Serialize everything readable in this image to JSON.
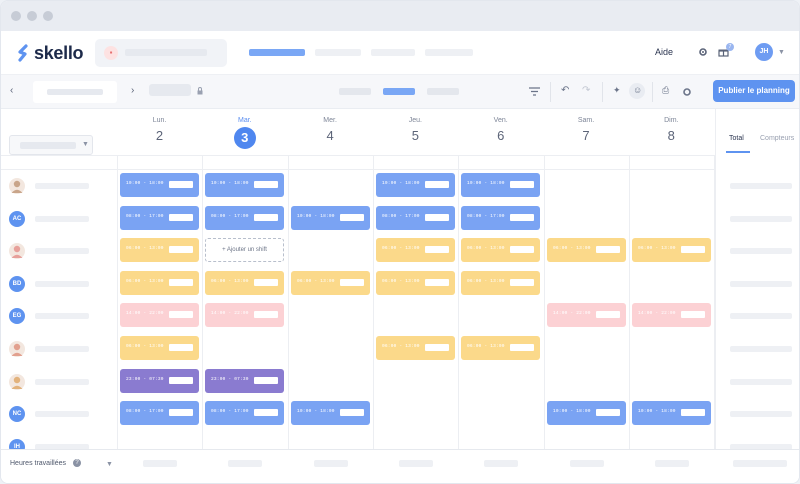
{
  "brand": {
    "name": "skello",
    "accent": "#5e93f0"
  },
  "topbar": {
    "help_label": "Aide",
    "user_initials": "JH",
    "notif_count": "7"
  },
  "toolbar": {
    "publish_label": "Publier le planning"
  },
  "days": [
    {
      "name": "Lun.",
      "num": "2",
      "today": false
    },
    {
      "name": "Mar.",
      "num": "3",
      "today": true
    },
    {
      "name": "Mer.",
      "num": "4",
      "today": false
    },
    {
      "name": "Jeu.",
      "num": "5",
      "today": false
    },
    {
      "name": "Ven.",
      "num": "6",
      "today": false
    },
    {
      "name": "Sam.",
      "num": "7",
      "today": false
    },
    {
      "name": "Dim.",
      "num": "8",
      "today": false
    }
  ],
  "right_panel": {
    "tab_total": "Total",
    "tab_counters": "Compteurs"
  },
  "employees": [
    {
      "initials": "",
      "photo": true,
      "color": "#c9a58a"
    },
    {
      "initials": "AC",
      "photo": false,
      "color": "#5e93f0"
    },
    {
      "initials": "",
      "photo": true,
      "color": "#e7a09a"
    },
    {
      "initials": "BD",
      "photo": false,
      "color": "#5e93f0"
    },
    {
      "initials": "EG",
      "photo": false,
      "color": "#5e93f0"
    },
    {
      "initials": "",
      "photo": true,
      "color": "#e2a08e"
    },
    {
      "initials": "",
      "photo": true,
      "color": "#e2b27c"
    },
    {
      "initials": "NC",
      "photo": false,
      "color": "#5e93f0"
    },
    {
      "initials": "IH",
      "photo": false,
      "color": "#5e93f0"
    }
  ],
  "shifts": [
    {
      "row": 0,
      "day": 0,
      "color": "blue",
      "time": "10:00 - 18:00"
    },
    {
      "row": 0,
      "day": 1,
      "color": "blue",
      "time": "10:00 - 18:00"
    },
    {
      "row": 0,
      "day": 3,
      "color": "blue",
      "time": "10:00 - 18:00"
    },
    {
      "row": 0,
      "day": 4,
      "color": "blue",
      "time": "10:00 - 18:00"
    },
    {
      "row": 1,
      "day": 0,
      "color": "blue",
      "time": "08:00 - 17:00"
    },
    {
      "row": 1,
      "day": 1,
      "color": "blue",
      "time": "08:00 - 17:00"
    },
    {
      "row": 1,
      "day": 2,
      "color": "blue",
      "time": "10:00 - 18:00"
    },
    {
      "row": 1,
      "day": 3,
      "color": "blue",
      "time": "08:00 - 17:00"
    },
    {
      "row": 1,
      "day": 4,
      "color": "blue",
      "time": "08:00 - 17:00"
    },
    {
      "row": 2,
      "day": 0,
      "color": "yellow",
      "time": "06:00 - 13:00"
    },
    {
      "row": 2,
      "day": 3,
      "color": "yellow",
      "time": "06:00 - 13:00"
    },
    {
      "row": 2,
      "day": 4,
      "color": "yellow",
      "time": "06:00 - 13:00"
    },
    {
      "row": 2,
      "day": 5,
      "color": "yellow",
      "time": "06:00 - 13:00"
    },
    {
      "row": 2,
      "day": 6,
      "color": "yellow",
      "time": "06:00 - 13:00"
    },
    {
      "row": 3,
      "day": 0,
      "color": "yellow",
      "time": "06:00 - 13:00"
    },
    {
      "row": 3,
      "day": 1,
      "color": "yellow",
      "time": "06:00 - 13:00"
    },
    {
      "row": 3,
      "day": 2,
      "color": "yellow",
      "time": "06:00 - 13:00"
    },
    {
      "row": 3,
      "day": 3,
      "color": "yellow",
      "time": "06:00 - 13:00"
    },
    {
      "row": 3,
      "day": 4,
      "color": "yellow",
      "time": "06:00 - 13:00"
    },
    {
      "row": 4,
      "day": 0,
      "color": "pink",
      "time": "14:00 - 22:00"
    },
    {
      "row": 4,
      "day": 1,
      "color": "pink",
      "time": "14:00 - 22:00"
    },
    {
      "row": 4,
      "day": 5,
      "color": "pink",
      "time": "14:00 - 22:00"
    },
    {
      "row": 4,
      "day": 6,
      "color": "pink",
      "time": "14:00 - 22:00"
    },
    {
      "row": 5,
      "day": 0,
      "color": "yellow",
      "time": "06:00 - 13:00"
    },
    {
      "row": 5,
      "day": 3,
      "color": "yellow",
      "time": "06:00 - 13:00"
    },
    {
      "row": 5,
      "day": 4,
      "color": "yellow",
      "time": "06:00 - 13:00"
    },
    {
      "row": 6,
      "day": 0,
      "color": "purple",
      "time": "23:00 - 07:30"
    },
    {
      "row": 6,
      "day": 1,
      "color": "purple",
      "time": "23:00 - 07:30"
    },
    {
      "row": 7,
      "day": 0,
      "color": "blue",
      "time": "08:00 - 17:00"
    },
    {
      "row": 7,
      "day": 1,
      "color": "blue",
      "time": "08:00 - 17:00"
    },
    {
      "row": 7,
      "day": 2,
      "color": "blue",
      "time": "10:00 - 18:00"
    },
    {
      "row": 7,
      "day": 5,
      "color": "blue",
      "time": "10:00 - 18:00"
    },
    {
      "row": 7,
      "day": 6,
      "color": "blue",
      "time": "10:00 - 18:00"
    }
  ],
  "add_shift": {
    "row": 2,
    "day": 1,
    "label": "+ Ajouter un shift"
  },
  "footer": {
    "hours_label": "Heures travaillées",
    "help_mark": "?"
  }
}
